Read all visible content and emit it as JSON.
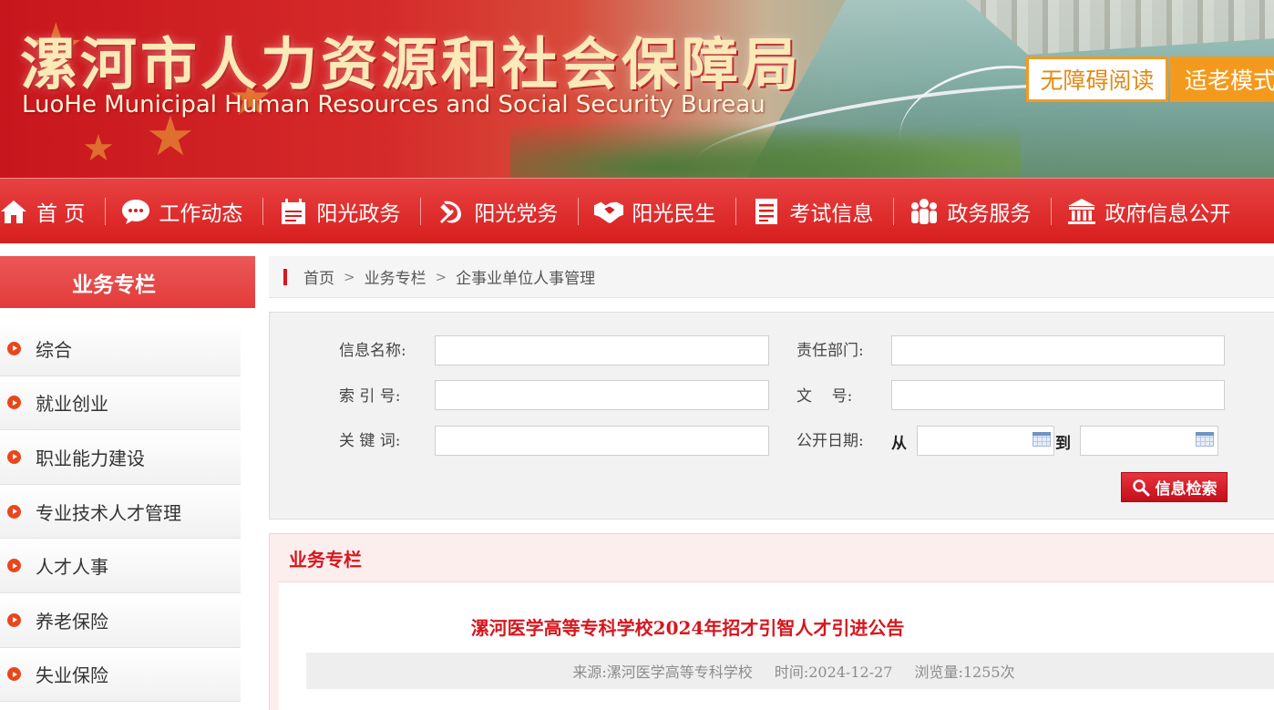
{
  "banner": {
    "title": "漯河市人力资源和社会保障局",
    "subtitle": "LuoHe Municipal Human Resources and Social Security Bureau",
    "accessible_reading": "无障碍阅读",
    "elderly_mode": "适老模式"
  },
  "nav": {
    "items": [
      {
        "label": "首 页",
        "icon": "home-icon"
      },
      {
        "label": "工作动态",
        "icon": "chat-bubble-icon"
      },
      {
        "label": "阳光政务",
        "icon": "calendar-icon"
      },
      {
        "label": "阳光党务",
        "icon": "hammer-sickle-icon"
      },
      {
        "label": "阳光民生",
        "icon": "handshake-icon"
      },
      {
        "label": "考试信息",
        "icon": "document-list-icon"
      },
      {
        "label": "政务服务",
        "icon": "people-icon"
      },
      {
        "label": "政府信息公开",
        "icon": "government-building-icon"
      }
    ]
  },
  "sidebar": {
    "title": "业务专栏",
    "items": [
      {
        "label": "综合"
      },
      {
        "label": "就业创业"
      },
      {
        "label": "职业能力建设"
      },
      {
        "label": "专业技术人才管理"
      },
      {
        "label": "人才人事"
      },
      {
        "label": "养老保险"
      },
      {
        "label": "失业保险"
      }
    ]
  },
  "breadcrumb": {
    "home": "首页",
    "section": "业务专栏",
    "current": "企事业单位人事管理"
  },
  "search": {
    "name_label": "信息名称:",
    "name_value": "",
    "dept_label": "责任部门:",
    "dept_value": "",
    "index_label": "索 引 号:",
    "index_value": "",
    "docno_label": "文    号:",
    "docno_value": "",
    "keyword_label": "关 键 词:",
    "keyword_value": "",
    "date_label": "公开日期:",
    "date_from_label": "从",
    "date_to_label": "到",
    "date_from_value": "",
    "date_to_value": "",
    "button_label": "信息检索"
  },
  "content": {
    "section_title": "业务专栏",
    "article": {
      "title": "漯河医学高等专科学校2024年招才引智人才引进公告",
      "source": "来源:漯河医学高等专科学校",
      "time": "时间:2024-12-27",
      "views": "浏览量:1255次"
    }
  },
  "colors": {
    "primary_red": "#d81e1e",
    "accent_orange": "#f39a1e",
    "title_red": "#d7161d"
  }
}
